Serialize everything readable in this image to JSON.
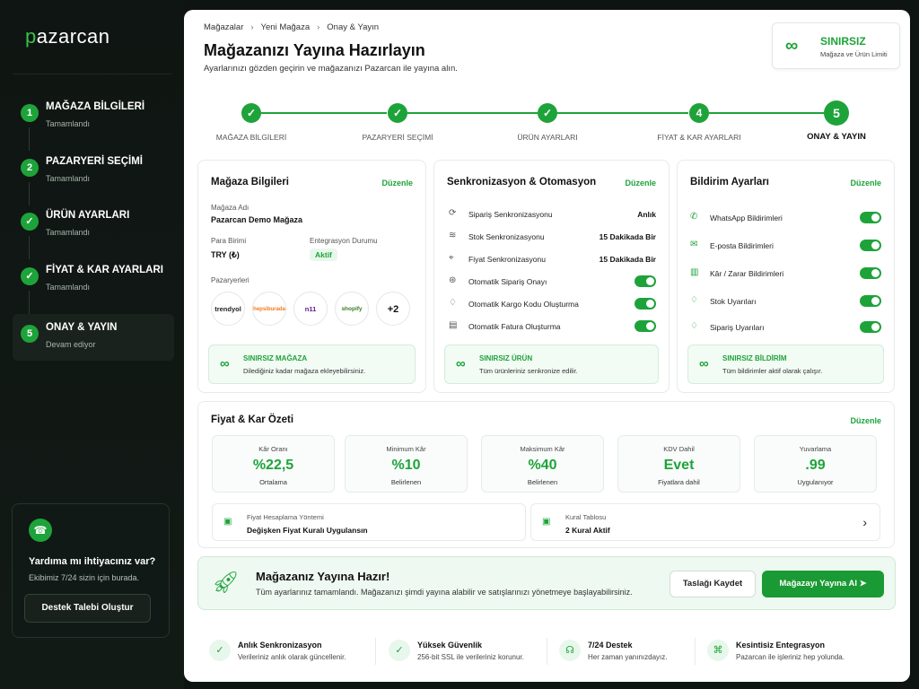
{
  "app": {
    "logo_prefix": "p",
    "logo_rest": "azarcan"
  },
  "sidebar": {
    "steps": [
      {
        "num": "1",
        "title": "MAĞAZA BİLGİLERİ",
        "status": "Tamamlandı"
      },
      {
        "num": "2",
        "title": "PAZARYERİ SEÇİMİ",
        "status": "Tamamlandı"
      },
      {
        "num": "✓",
        "title": "ÜRÜN AYARLARI",
        "status": "Tamamlandı"
      },
      {
        "num": "✓",
        "title": "FİYAT & KAR AYARLARI",
        "status": "Tamamlandı"
      },
      {
        "num": "5",
        "title": "ONAY & YAYIN",
        "status": "Devam ediyor"
      }
    ],
    "help": {
      "title": "Yardıma mı ihtiyacınız var?",
      "subtitle": "Ekibimiz 7/24 sizin için burada.",
      "button": "Destek Talebi Oluştur"
    }
  },
  "header": {
    "breadcrumb": [
      "Mağazalar",
      "Yeni Mağaza",
      "Onay & Yayın"
    ],
    "title": "Mağazanızı Yayına Hazırlayın",
    "subtitle": "Ayarlarınızı gözden geçirin ve mağazanızı Pazarcan ile yayına alın.",
    "badge_title": "SINIRSIZ",
    "badge_sub": "Mağaza ve Ürün Limiti"
  },
  "progress": {
    "steps": [
      {
        "label": "MAĞAZA BİLGİLERİ",
        "mark": "✓"
      },
      {
        "label": "PAZARYERİ SEÇİMİ",
        "mark": "✓"
      },
      {
        "label": "ÜRÜN AYARLARI",
        "mark": "✓"
      },
      {
        "label": "FİYAT & KAR AYARLARI",
        "mark": "4"
      },
      {
        "label": "ONAY & YAYIN",
        "mark": "5"
      }
    ]
  },
  "store_card": {
    "title": "Mağaza Bilgileri",
    "edit": "Düzenle",
    "name_label": "Mağaza Adı",
    "name_value": "Pazarcan Demo Mağaza",
    "currency_label": "Para Birimi",
    "currency_value": "TRY (₺)",
    "integration_label": "Entegrasyon Durumu",
    "integration_value": "Aktif",
    "marketplaces_label": "Pazaryerleri",
    "marketplaces": [
      "trendyol",
      "hepsiburada",
      "n11",
      "shopify",
      "+2"
    ],
    "info_title": "SINIRSIZ MAĞAZA",
    "info_sub": "Dilediğiniz kadar mağaza ekleyebilirsiniz."
  },
  "sync_card": {
    "title": "Senkronizasyon & Otomasyon",
    "edit": "Düzenle",
    "rows": [
      {
        "label": "Sipariş Senkronizasyonu",
        "value": "Anlık"
      },
      {
        "label": "Stok Senkronizasyonu",
        "value": "15 Dakikada Bir"
      },
      {
        "label": "Fiyat Senkronizasyonu",
        "value": "15 Dakikada Bir"
      }
    ],
    "toggles": [
      "Otomatik Sipariş Onayı",
      "Otomatik Kargo Kodu Oluşturma",
      "Otomatik Fatura Oluşturma"
    ],
    "info_title": "SINIRSIZ ÜRÜN",
    "info_sub": "Tüm ürünleriniz senkronize edilir."
  },
  "notify_card": {
    "title": "Bildirim Ayarları",
    "edit": "Düzenle",
    "toggles": [
      "WhatsApp Bildirimleri",
      "E-posta Bildirimleri",
      "Kâr / Zarar Bildirimleri",
      "Stok Uyarıları",
      "Sipariş Uyarıları"
    ],
    "info_title": "SINIRSIZ BİLDİRİM",
    "info_sub": "Tüm bildirimler aktif olarak çalışır."
  },
  "price_card": {
    "title": "Fiyat & Kar Özeti",
    "edit": "Düzenle",
    "stats": [
      {
        "label": "Kâr Oranı",
        "value": "%22,5",
        "sub": "Ortalama"
      },
      {
        "label": "Minimum Kâr",
        "value": "%10",
        "sub": "Belirlenen"
      },
      {
        "label": "Maksimum Kâr",
        "value": "%40",
        "sub": "Belirlenen"
      },
      {
        "label": "KDV Dahil",
        "value": "Evet",
        "sub": "Fiyatlara dahil"
      },
      {
        "label": "Yuvarlama",
        "value": ".99",
        "sub": "Uygulanıyor"
      }
    ],
    "method_label": "Fiyat Hesaplama Yöntemi",
    "method_value": "Değişken Fiyat Kuralı Uygulansın",
    "table_label": "Kural Tablosu",
    "table_value": "2 Kural Aktif"
  },
  "ready": {
    "title": "Mağazanız Yayına Hazır!",
    "subtitle": "Tüm ayarlarınız tamamlandı. Mağazanızı şimdi yayına alabilir ve satışlarınızı yönetmeye başlayabilirsiniz.",
    "draft_button": "Taslağı Kaydet",
    "publish_button": "Mağazayı Yayına Al"
  },
  "features": [
    {
      "title": "Anlık Senkronizasyon",
      "sub": "Verileriniz anlık olarak güncellenir."
    },
    {
      "title": "Yüksek Güvenlik",
      "sub": "256-bit SSL ile verileriniz korunur."
    },
    {
      "title": "7/24 Destek",
      "sub": "Her zaman yanınızdayız."
    },
    {
      "title": "Kesintisiz Entegrasyon",
      "sub": "Pazarcan ile işleriniz hep yolunda."
    }
  ],
  "colors": {
    "accent": "#1ea33a",
    "sidebar_bg": "#0f1512"
  }
}
